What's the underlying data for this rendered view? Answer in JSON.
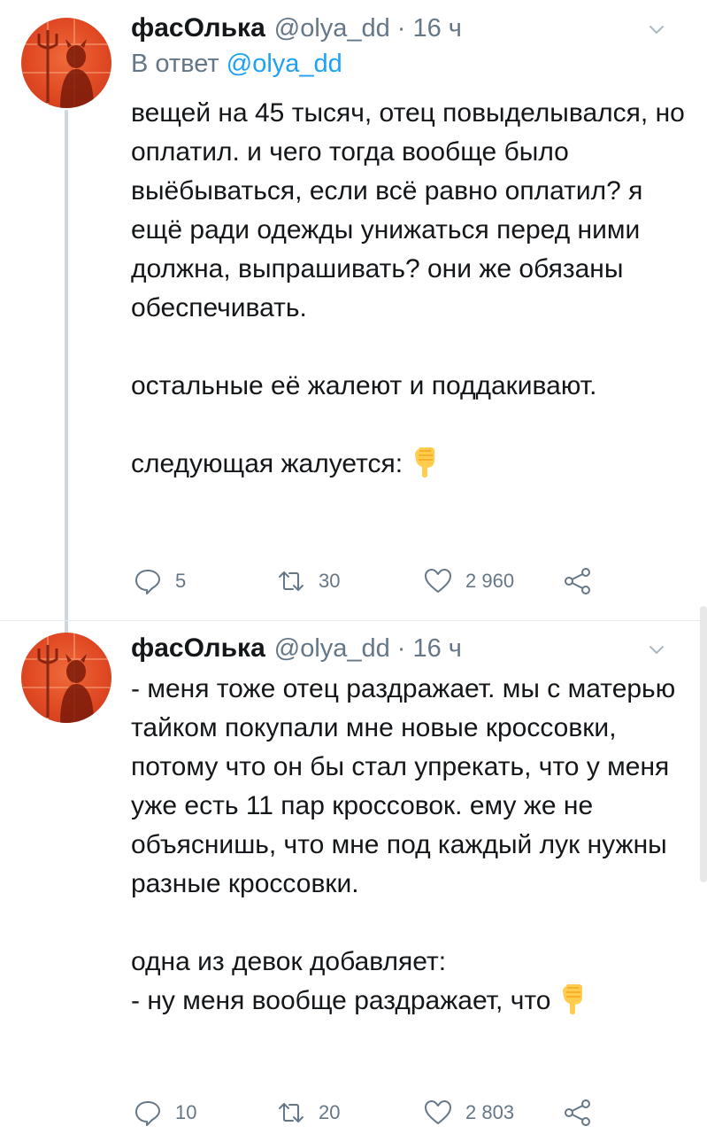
{
  "tweets": [
    {
      "author_name": "фасОлька",
      "handle": "@olya_dd",
      "dot": "·",
      "time": "16 ч",
      "reply_prefix": "В ответ",
      "reply_handle": "@olya_dd",
      "text": "вещей на 45 тысяч, отец повыделывался, но оплатил. и чего тогда вообще было выёбываться, если всё равно оплатил? я ещё ради одежды унижаться перед ними должна, выпрашивать? они же обязаны обеспечивать.\n\nостальные её жалеют и поддакивают.\n\nследующая жалуется:",
      "trailing_emoji": "pointing-down-emoji",
      "replies": "5",
      "retweets": "30",
      "likes": "2 960"
    },
    {
      "author_name": "фасОлька",
      "handle": "@olya_dd",
      "dot": "·",
      "time": "16 ч",
      "text": "- меня тоже отец раздражает. мы с матерью тайком покупали мне новые кроссовки, потому что он бы стал упрекать, что у меня уже есть 11 пар кроссовок. ему же не объяснишь, что мне под каждый лук нужны разные кроссовки.\n\nодна из девок добавляет:\n- ну меня вообще раздражает, что",
      "trailing_emoji": "pointing-down-emoji",
      "replies": "10",
      "retweets": "20",
      "likes": "2 803"
    }
  ],
  "colors": {
    "text": "#14171a",
    "secondary": "#657786",
    "link": "#1da1f2",
    "thread_line": "#cbd6de",
    "avatar_bg": "#e04a24"
  },
  "icons": {
    "reply": "reply-icon",
    "retweet": "retweet-icon",
    "like": "heart-icon",
    "share": "share-icon",
    "caret": "chevron-down-icon"
  }
}
